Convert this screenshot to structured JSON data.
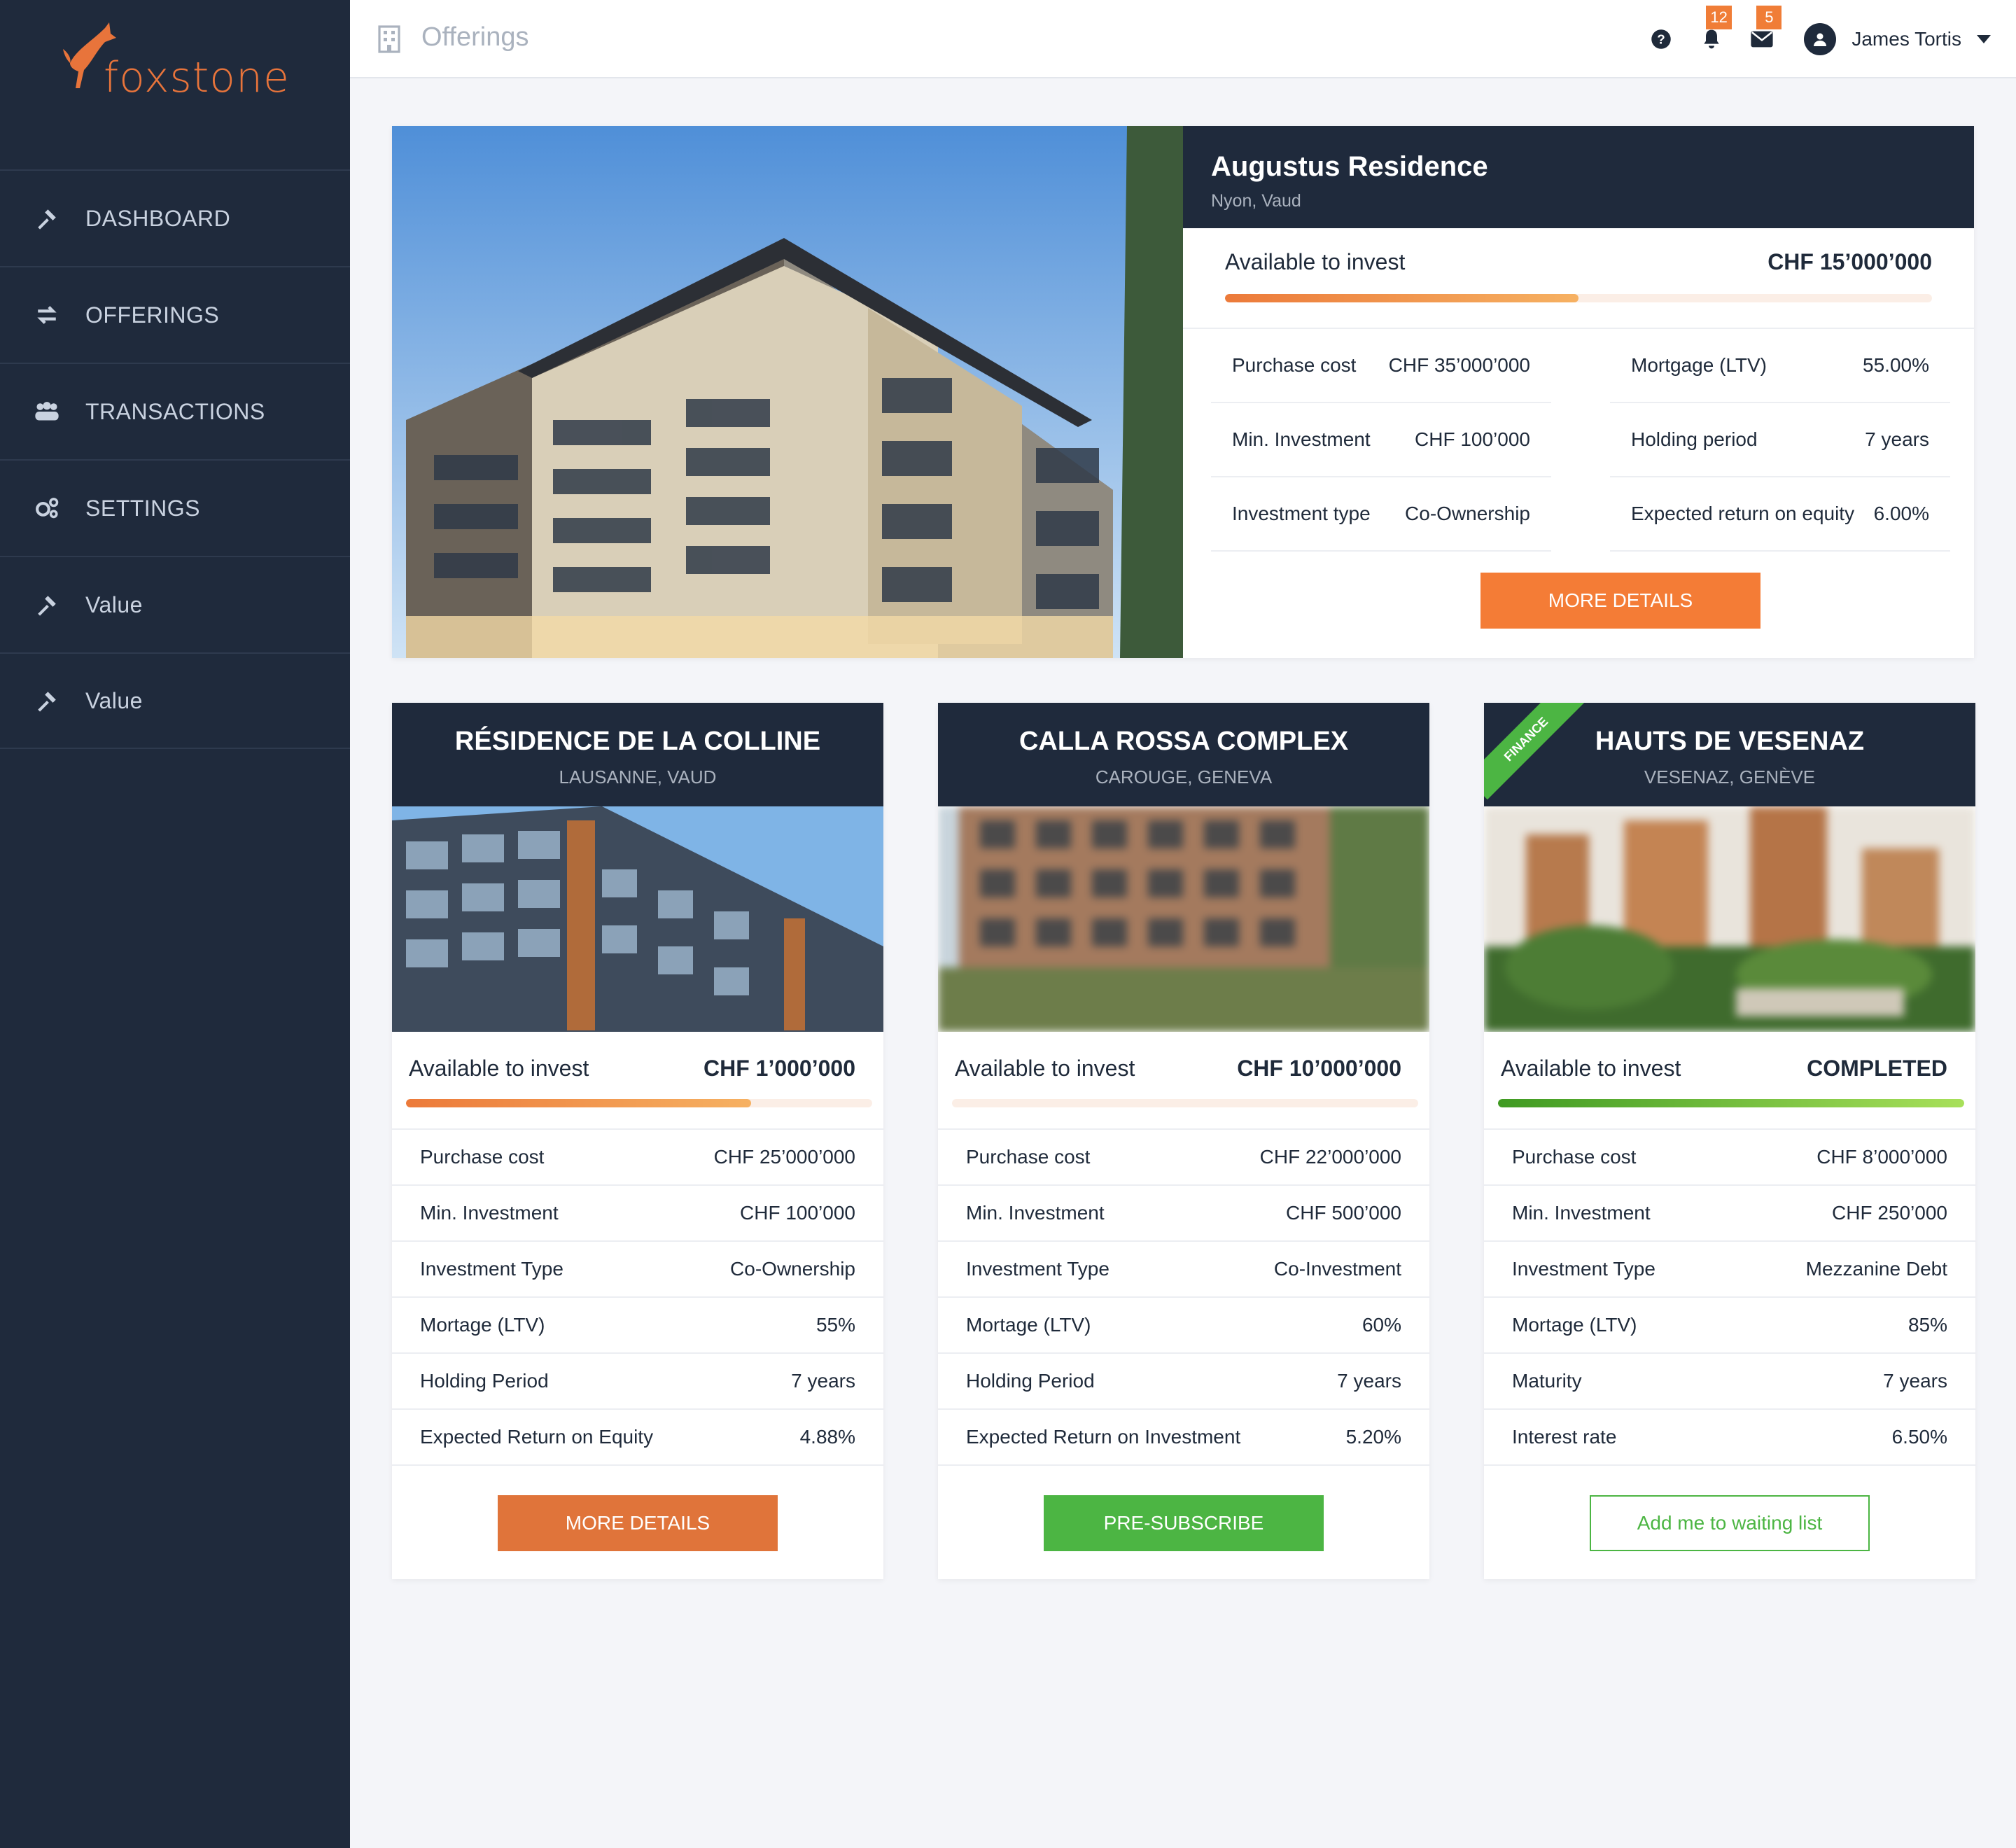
{
  "brand": {
    "name": "foxstone",
    "accent": "#e8743b"
  },
  "sidebar": {
    "items": [
      {
        "label": "DASHBOARD",
        "icon": "gavel-icon"
      },
      {
        "label": "OFFERINGS",
        "icon": "exchange-icon"
      },
      {
        "label": "TRANSACTIONS",
        "icon": "users-icon"
      },
      {
        "label": "SETTINGS",
        "icon": "gears-icon"
      },
      {
        "label": "Value",
        "icon": "gavel-icon"
      },
      {
        "label": "Value",
        "icon": "gavel-icon"
      }
    ]
  },
  "header": {
    "title": "Offerings",
    "notifications_count": "12",
    "messages_count": "5",
    "user_name": "James Tortis"
  },
  "featured": {
    "title": "Augustus Residence",
    "location": "Nyon, Vaud",
    "available_label": "Available to invest",
    "available_amount": "CHF 15’000’000",
    "progress": 0.5,
    "left_rows": [
      {
        "label": "Purchase cost",
        "value": "CHF 35’000’000"
      },
      {
        "label": "Min. Investment",
        "value": "CHF 100’000"
      },
      {
        "label": "Investment type",
        "value": "Co-Ownership"
      }
    ],
    "right_rows": [
      {
        "label": "Mortgage (LTV)",
        "value": "55.00%"
      },
      {
        "label": "Holding period",
        "value": "7 years"
      },
      {
        "label": "Expected return on equity",
        "value": "6.00%"
      }
    ],
    "button": "MORE DETAILS"
  },
  "cards": [
    {
      "title": "RÉSIDENCE DE LA COLLINE",
      "location": "LAUSANNE, VAUD",
      "available_label": "Available to invest",
      "available_amount": "CHF 1’000’000",
      "progress": 0.74,
      "rows": [
        {
          "label": "Purchase cost",
          "value": "CHF 25’000’000"
        },
        {
          "label": "Min. Investment",
          "value": "CHF 100’000"
        },
        {
          "label": "Investment Type",
          "value": "Co-Ownership"
        },
        {
          "label": "Mortage (LTV)",
          "value": "55%"
        },
        {
          "label": "Holding Period",
          "value": "7 years"
        },
        {
          "label": "Expected Return on Equity",
          "value": "4.88%"
        }
      ],
      "button": "MORE DETAILS"
    },
    {
      "title": "CALLA ROSSA COMPLEX",
      "location": "CAROUGE, GENEVA",
      "available_label": "Available to invest",
      "available_amount": "CHF 10’000’000",
      "progress": 0.0,
      "rows": [
        {
          "label": "Purchase cost",
          "value": "CHF 22’000’000"
        },
        {
          "label": "Min. Investment",
          "value": "CHF 500’000"
        },
        {
          "label": "Investment Type",
          "value": "Co-Investment"
        },
        {
          "label": "Mortage (LTV)",
          "value": "60%"
        },
        {
          "label": "Holding Period",
          "value": "7 years"
        },
        {
          "label": "Expected Return on Investment",
          "value": "5.20%"
        }
      ],
      "button": "PRE-SUBSCRIBE"
    },
    {
      "title": "HAUTS DE VESENAZ",
      "location": "VESENAZ, GENÈVE",
      "ribbon": "FINANCE",
      "available_label": "Available to invest",
      "available_amount": "COMPLETED",
      "progress": 1.0,
      "rows": [
        {
          "label": "Purchase cost",
          "value": "CHF 8’000’000"
        },
        {
          "label": "Min. Investment",
          "value": "CHF 250’000"
        },
        {
          "label": "Investment Type",
          "value": "Mezzanine Debt"
        },
        {
          "label": "Mortage (LTV)",
          "value": "85%"
        },
        {
          "label": "Maturity",
          "value": "7 years"
        },
        {
          "label": "Interest rate",
          "value": "6.50%"
        }
      ],
      "button": "Add me to waiting list"
    }
  ]
}
